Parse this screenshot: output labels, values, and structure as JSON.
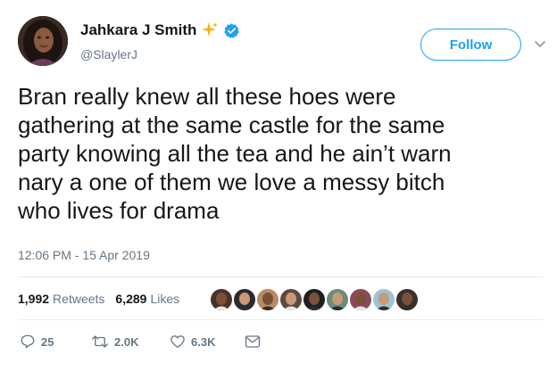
{
  "author": {
    "display_name": "Jahkara J Smith",
    "handle": "@SlaylerJ",
    "name_emoji": "sparkles-icon",
    "verified": true
  },
  "follow_button": {
    "label": "Follow"
  },
  "tweet": {
    "text": "Bran really knew all these hoes were\ngathering at the same castle for the same\nparty knowing all the tea and he ain’t warn\nnary a one of them we love a messy bitch\nwho lives for drama",
    "timestamp": "12:06 PM - 15 Apr 2019"
  },
  "stats": {
    "retweets_count": "1,992",
    "retweets_label": "Retweets",
    "likes_count": "6,289",
    "likes_label": "Likes"
  },
  "likers": [
    {
      "bg": "#4a3326"
    },
    {
      "bg": "#2b2b2b"
    },
    {
      "bg": "#b98a63"
    },
    {
      "bg": "#5c4a3f"
    },
    {
      "bg": "#1f1f1f"
    },
    {
      "bg": "#6b8b7b"
    },
    {
      "bg": "#8a4a5c"
    },
    {
      "bg": "#9cc4d8"
    },
    {
      "bg": "#3b2f2a"
    }
  ],
  "actions": {
    "reply_count": "25",
    "retweet_count": "2.0K",
    "like_count": "6.3K"
  },
  "colors": {
    "accent": "#1da1f2",
    "text": "#14171a",
    "muted": "#657786",
    "divider": "#e6ecf0",
    "sparkle": "#f5b301"
  }
}
